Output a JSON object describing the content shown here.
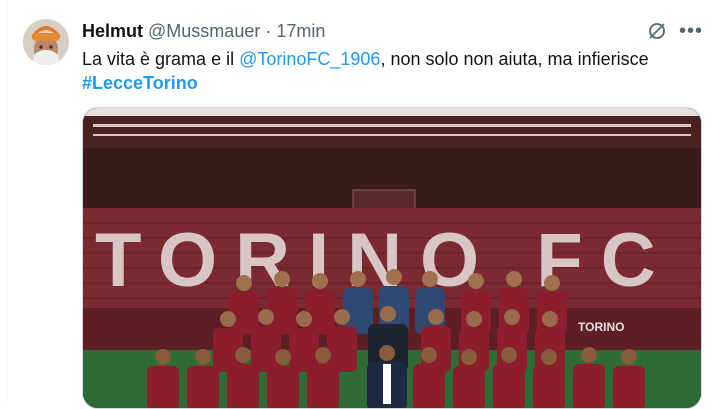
{
  "tweet": {
    "display_name": "Helmut",
    "handle": "@Mussmauer",
    "separator": "·",
    "timestamp": "17min",
    "text_before": "La vita è grama e il ",
    "mention": "@TorinoFC_1906",
    "text_after": ", non solo non aiuta, ma infierisce",
    "hashtag": "#LecceTorino"
  },
  "media": {
    "stadium_lettering": "TORINO FC",
    "banner_text": "TORINO"
  },
  "icons": {
    "grok": "grok-icon",
    "more": "more-icon"
  },
  "colors": {
    "link": "#1d9bf0",
    "seats": "#7a2a30",
    "jersey": "#8b1d2c",
    "gk_jersey": "#2f4a72",
    "pitch": "#2f6b35"
  }
}
